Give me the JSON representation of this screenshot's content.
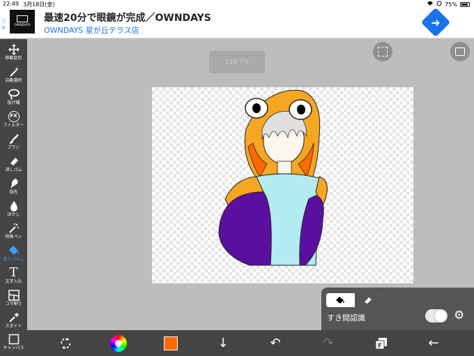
{
  "statusbar": {
    "time": "22:49",
    "date": "3月18日(金)",
    "battery": "75%"
  },
  "ad": {
    "logo_text": "OWNDAYS",
    "title": "最速20分で眼鏡が完成／OWNDAYS",
    "subtitle": "OWNDAYS 星が丘テラス店"
  },
  "tools": [
    {
      "label": "移動変形",
      "icon": "move-icon"
    },
    {
      "label": "自動選択",
      "icon": "magic-wand-icon"
    },
    {
      "label": "投げ縄",
      "icon": "lasso-icon"
    },
    {
      "label": "フィルター",
      "icon": "filter-fx-icon",
      "glyph": "FX"
    },
    {
      "label": "ブラシ",
      "icon": "brush-icon"
    },
    {
      "label": "消しゴム",
      "icon": "eraser-icon"
    },
    {
      "label": "指先",
      "icon": "finger-icon"
    },
    {
      "label": "ぼかし",
      "icon": "blur-icon"
    },
    {
      "label": "特殊ペン",
      "icon": "special-pen-icon"
    },
    {
      "label": "塗りつぶし",
      "icon": "fill-bucket-icon",
      "active": true
    },
    {
      "label": "文字入れ",
      "icon": "text-icon",
      "glyph": "T"
    },
    {
      "label": "コマ割り",
      "icon": "panel-divide-icon"
    },
    {
      "label": "スポイト",
      "icon": "eyedropper-icon"
    },
    {
      "label": "キャンバス",
      "icon": "canvas-icon"
    }
  ],
  "canvas": {
    "zoom": "110.7%"
  },
  "fill_panel": {
    "gap_label": "すき間認識",
    "toggle_on": false
  },
  "colors": {
    "current": "#ff6a00",
    "active_tool": "#3aa0ff",
    "toolbar_bg": "#444444",
    "ad_accent": "#1a73e8"
  }
}
